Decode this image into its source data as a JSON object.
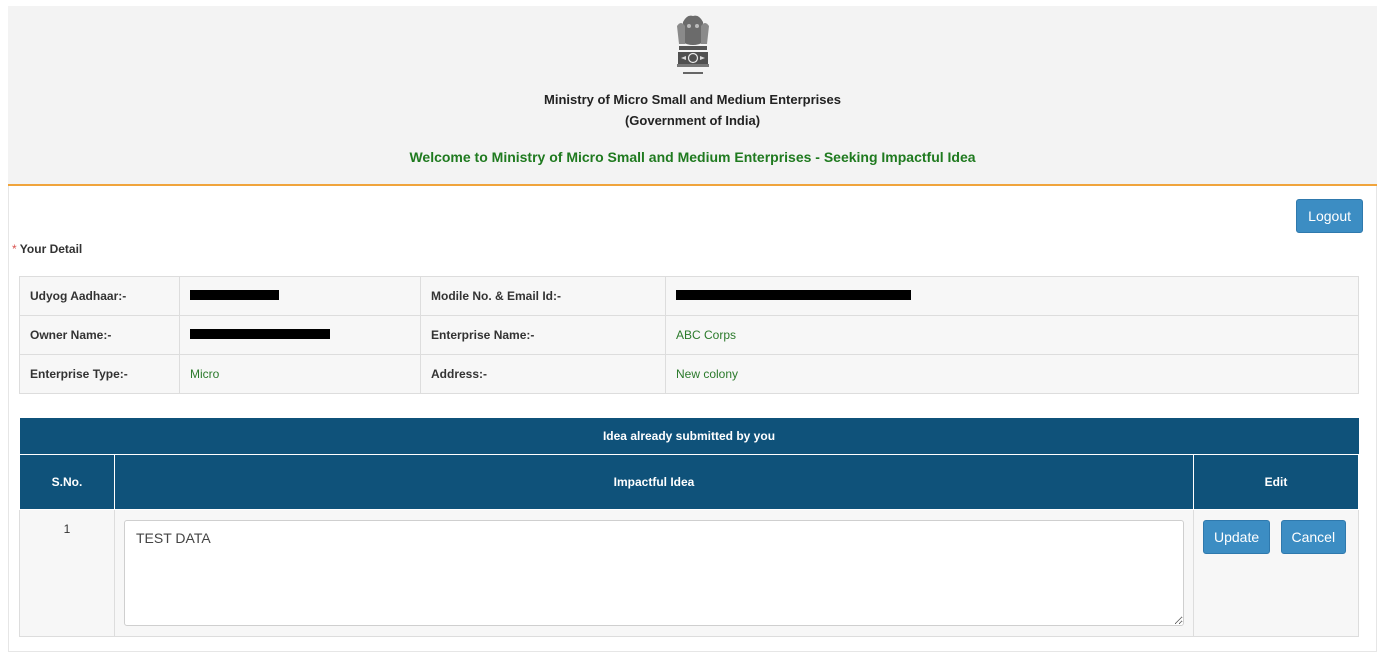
{
  "header": {
    "ministry_name": "Ministry of Micro Small and Medium Enterprises",
    "government": "(Government of India)",
    "welcome": "Welcome to Ministry of Micro Small and Medium Enterprises - Seeking Impactful Idea",
    "emblem_icon": "india-emblem-icon"
  },
  "actions": {
    "logout_label": "Logout"
  },
  "details": {
    "section_marker": "*",
    "section_title": "Your Detail",
    "udyog_aadhaar_label": "Udyog Aadhaar:-",
    "mobile_email_label": "Modile No. & Email Id:-",
    "owner_name_label": "Owner Name:-",
    "enterprise_name_label": "Enterprise Name:-",
    "enterprise_name_value": "ABC Corps",
    "enterprise_type_label": "Enterprise Type:-",
    "enterprise_type_value": "Micro",
    "address_label": "Address:-",
    "address_value": "New colony"
  },
  "ideas": {
    "caption": "Idea already submitted by you",
    "columns": [
      "S.No.",
      "Impactful Idea",
      "Edit"
    ],
    "rows": [
      {
        "sno": "1",
        "idea": "TEST DATA"
      }
    ],
    "update_label": "Update",
    "cancel_label": "Cancel"
  },
  "colors": {
    "header_bg": "#f3f3f3",
    "accent_line": "#f0a43c",
    "welcome_text": "#1f7a1f",
    "table_header": "#0f527a",
    "button": "#3c8dc3"
  }
}
